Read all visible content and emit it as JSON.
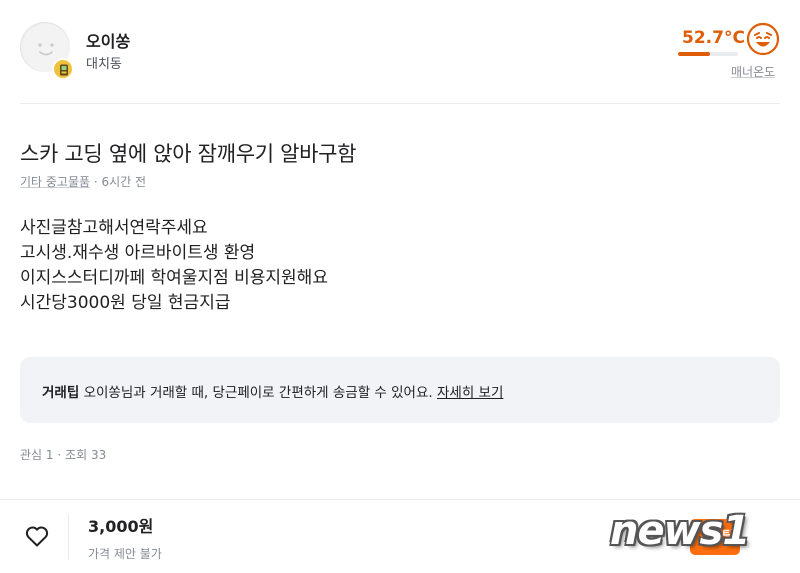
{
  "seller": {
    "nickname": "오이쏭",
    "region": "대치동",
    "manner_temperature": "52.7°C",
    "manner_temperature_value": 52.7,
    "manner_label": "매너온도"
  },
  "article": {
    "title": "스카 고딩 옆에 앉아 잠깨우기 알바구함",
    "category": "기타 중고물품",
    "time_ago": "6시간 전",
    "description_lines": [
      "사진글참고해서연락주세요",
      "고시생.재수생 아르바이트생 환영",
      "이지스스터디까페 학여울지점 비용지원해요",
      "시간당3000원 당일 현금지급"
    ]
  },
  "tip": {
    "label": "거래팁",
    "text": "오이쏭님과 거래할 때, 당근페이로 간편하게 송금할 수 있어요.",
    "link": "자세히 보기"
  },
  "stats": {
    "interest_label": "관심",
    "interest": "1",
    "views_label": "조회",
    "views": "33"
  },
  "footer": {
    "price": "3,000원",
    "negotiation": "가격 제안 불가",
    "chat_button_label": "팅"
  },
  "watermark": {
    "text": "news1"
  },
  "colors": {
    "accent": "#ff6f0f",
    "temperature": "#de5d06",
    "text": "#212124",
    "muted": "#868b94",
    "tip_background": "#f2f3f6"
  },
  "icons": {
    "avatar": "default-profile-icon",
    "badge": "verified-badge-icon",
    "temperature_face": "smile-face-icon",
    "like": "heart-outline-icon"
  }
}
